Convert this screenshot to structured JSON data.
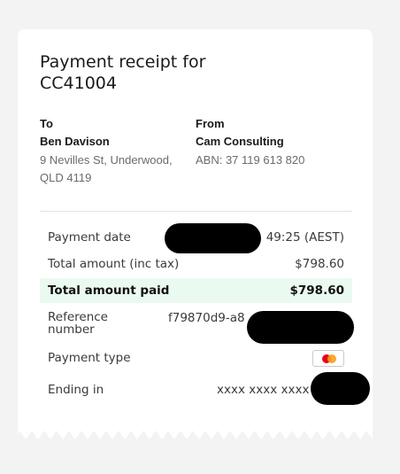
{
  "receipt": {
    "title": "Payment receipt for CC41004"
  },
  "to": {
    "heading": "To",
    "name": "Ben Davison",
    "address": "9 Nevilles St, Underwood, QLD 4119"
  },
  "from": {
    "heading": "From",
    "name": "Cam Consulting",
    "abn": "ABN: 37 119 613 820"
  },
  "details": {
    "payment_date_label": "Payment date",
    "payment_date_value": "49:25 (AEST)",
    "total_amount_label": "Total amount (inc tax)",
    "total_amount_value": "$798.60",
    "total_paid_label": "Total amount paid",
    "total_paid_value": "$798.60",
    "reference_label": "Reference number",
    "reference_value": "f79870d9-a8",
    "payment_type_label": "Payment type",
    "payment_type_icon": "mastercard-icon",
    "ending_label": "Ending in",
    "ending_value": "xxxx xxxx xxxx"
  },
  "colors": {
    "paid_highlight": "#eafaf0",
    "mastercard_red": "#eb001b",
    "mastercard_orange": "#f79e1b"
  }
}
